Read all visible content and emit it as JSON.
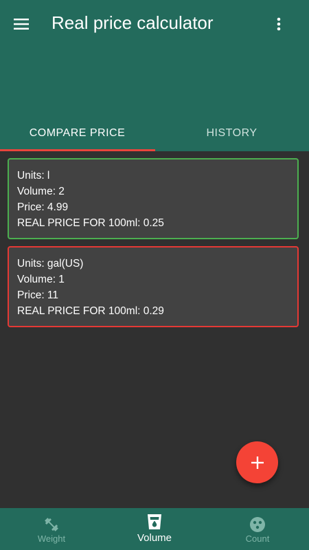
{
  "appbar": {
    "title": "Real price calculator",
    "menu_icon": "hamburger-menu-icon",
    "more_icon": "more-vert-icon",
    "color": "#236b5c"
  },
  "tabs": [
    {
      "label": "COMPARE PRICE",
      "selected": true
    },
    {
      "label": "HISTORY",
      "selected": false
    }
  ],
  "cards": [
    {
      "units": "Units: l",
      "volume": "Volume: 2",
      "price": "Price: 4.99",
      "real_price": "REAL PRICE FOR 100ml: 0.25",
      "border_color": "#4caf50"
    },
    {
      "units": "Units: gal(US)",
      "volume": "Volume: 1",
      "price": "Price: 11",
      "real_price": "REAL PRICE FOR 100ml: 0.29",
      "border_color": "#e53935"
    }
  ],
  "fab": {
    "icon": "plus-icon",
    "color": "#f44336"
  },
  "bottom_nav": [
    {
      "label": "Weight",
      "icon": "dumbbell-icon",
      "selected": false
    },
    {
      "label": "Volume",
      "icon": "cup-icon",
      "selected": true
    },
    {
      "label": "Count",
      "icon": "count-icon",
      "selected": false
    }
  ]
}
